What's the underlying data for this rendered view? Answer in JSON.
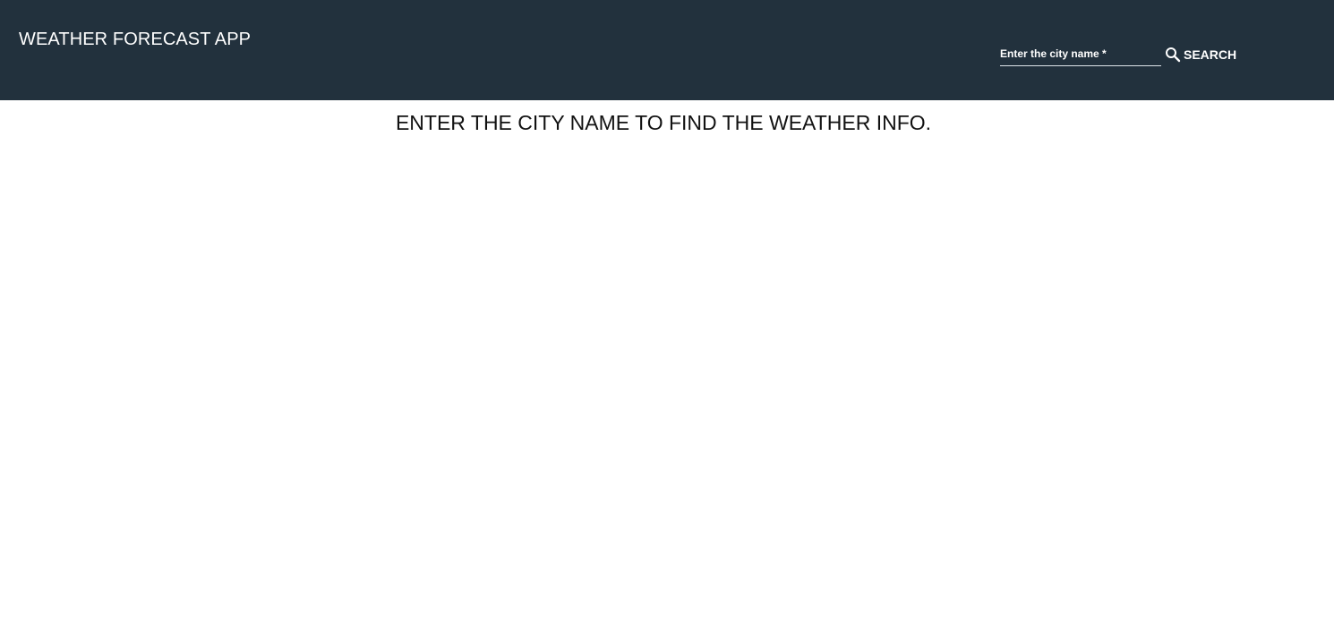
{
  "header": {
    "title": "WEATHER FORECAST APP",
    "background_color": "#22313d"
  },
  "search": {
    "placeholder": "Enter the city name *",
    "value": "",
    "button_label": "SEARCH",
    "icon": "search-icon"
  },
  "main": {
    "message": "ENTER THE CITY NAME TO FIND THE WEATHER INFO."
  }
}
